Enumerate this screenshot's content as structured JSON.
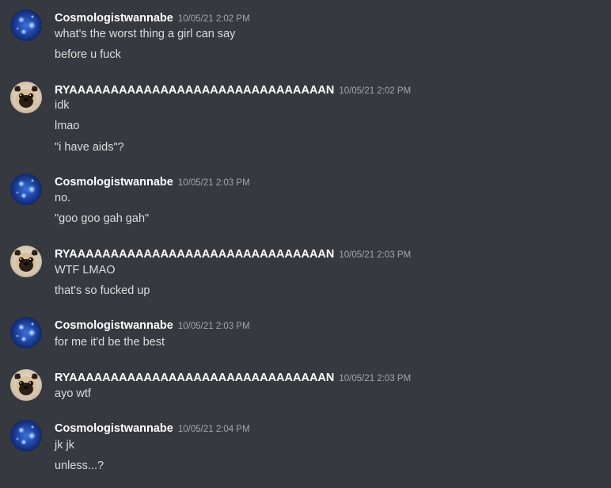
{
  "users": {
    "cosmo": "Cosmologistwannabe",
    "ryan": "RYAAAAAAAAAAAAAAAAAAAAAAAAAAAAAAAN"
  },
  "colors": {
    "background": "#36393f",
    "username": "#ffffff",
    "message_text": "#dcddde",
    "timestamp": "#a3a6aa"
  },
  "groups": [
    {
      "avatar_icon": "galaxy-avatar-icon",
      "username": "Cosmologistwannabe",
      "timestamp": "10/05/21 2:02 PM",
      "messages": [
        "what's the worst thing a girl can say",
        "before u fuck"
      ]
    },
    {
      "avatar_icon": "pug-avatar-icon",
      "username": "RYAAAAAAAAAAAAAAAAAAAAAAAAAAAAAAAN",
      "timestamp": "10/05/21 2:02 PM",
      "messages": [
        "idk",
        "lmao",
        "\"i have aids\"?"
      ]
    },
    {
      "avatar_icon": "galaxy-avatar-icon",
      "username": "Cosmologistwannabe",
      "timestamp": "10/05/21 2:03 PM",
      "messages": [
        "no.",
        "\"goo goo gah gah\""
      ]
    },
    {
      "avatar_icon": "pug-avatar-icon",
      "username": "RYAAAAAAAAAAAAAAAAAAAAAAAAAAAAAAAN",
      "timestamp": "10/05/21 2:03 PM",
      "messages": [
        "WTF LMAO",
        "that's so fucked up"
      ]
    },
    {
      "avatar_icon": "galaxy-avatar-icon",
      "username": "Cosmologistwannabe",
      "timestamp": "10/05/21 2:03 PM",
      "messages": [
        "for me it'd be the best"
      ]
    },
    {
      "avatar_icon": "pug-avatar-icon",
      "username": "RYAAAAAAAAAAAAAAAAAAAAAAAAAAAAAAAN",
      "timestamp": "10/05/21 2:03 PM",
      "messages": [
        "ayo wtf"
      ]
    },
    {
      "avatar_icon": "galaxy-avatar-icon",
      "username": "Cosmologistwannabe",
      "timestamp": "10/05/21 2:04 PM",
      "messages": [
        "jk jk",
        "unless...?"
      ]
    }
  ]
}
